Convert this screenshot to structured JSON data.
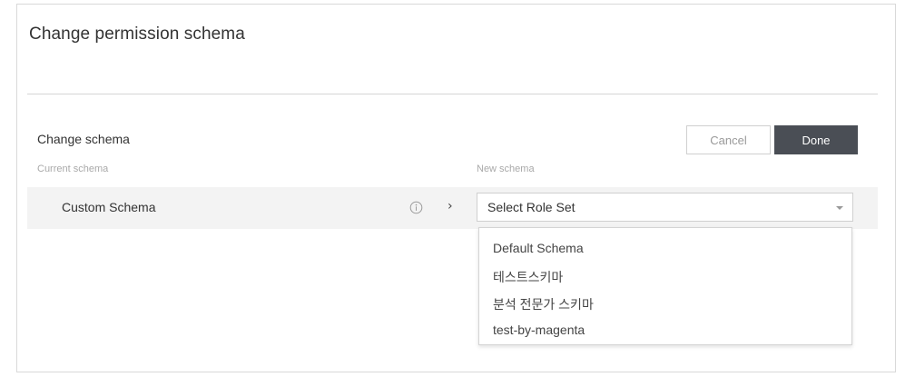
{
  "dialog": {
    "title": "Change permission schema"
  },
  "section": {
    "title": "Change schema",
    "current_label": "Current schema",
    "new_label": "New schema"
  },
  "buttons": {
    "cancel": "Cancel",
    "done": "Done"
  },
  "row": {
    "current_schema": "Custom Schema",
    "info_icon": "info-icon",
    "arrow_icon": "chevron-right-icon"
  },
  "select": {
    "value": "Select Role Set",
    "caret_icon": "caret-down-icon",
    "options": [
      "Default Schema",
      "테스트스키마",
      "분석 전문가 스키마",
      "test-by-magenta"
    ]
  },
  "colors": {
    "done_bg": "#4a4e55",
    "row_bg": "#f3f3f3",
    "border": "#d9d9d9"
  }
}
